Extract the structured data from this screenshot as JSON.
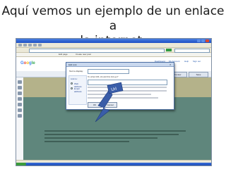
{
  "slide": {
    "title_line1": "Aquí vemos un ejemplo de un enlace a",
    "title_line2": "la internet."
  },
  "browser": {
    "window_title": "",
    "address": "",
    "tabs": [
      "Edit page",
      "Create new post"
    ]
  },
  "blogger": {
    "logo": {
      "g1": "G",
      "o1": "o",
      "o2": "o",
      "g2": "g",
      "le": "le"
    },
    "links": [
      "Dashboard",
      "My Account",
      "Help",
      "Sign out"
    ],
    "editor_tabs": [
      "Edit Html",
      "Compose"
    ],
    "buttons": [
      "Preview",
      "Save"
    ]
  },
  "dialog": {
    "title": "Edit Link",
    "close": "×",
    "text_label": "Text to display:",
    "text_value": "",
    "link_to_label": "Link to:",
    "options": [
      "Web address",
      "Email address"
    ],
    "sub_label": "To what URL should this link go?",
    "url_value": "",
    "ok_label": "OK",
    "cancel_label": "Cancel"
  },
  "callout": {
    "label": "Url",
    "color": "#3a5da8"
  },
  "status": {
    "text": ""
  }
}
